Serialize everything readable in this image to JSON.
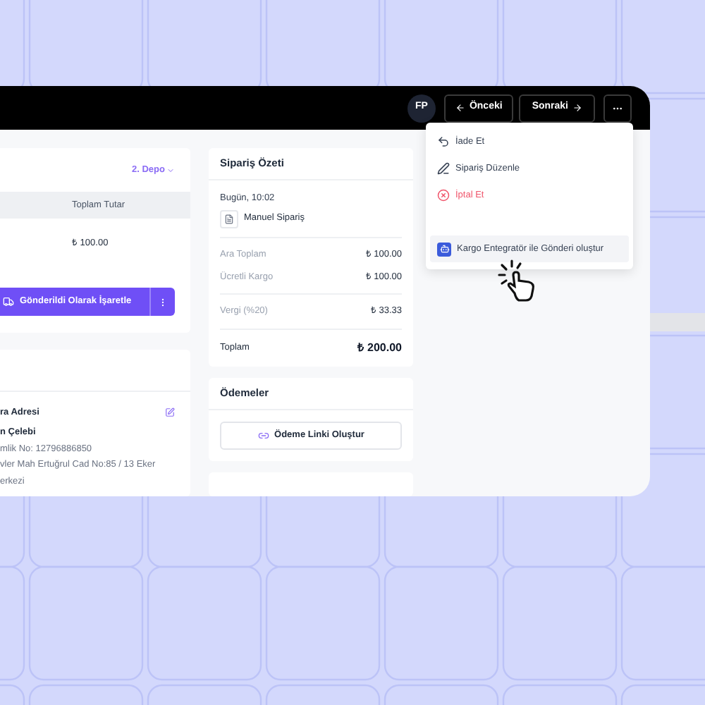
{
  "header": {
    "avatar": "FP",
    "prev": "Önceki",
    "next": "Sonraki"
  },
  "menu": {
    "items": [
      {
        "label": "İade Et",
        "kind": "return",
        "selected": false
      },
      {
        "label": "Sipariş Düzenle",
        "kind": "edit",
        "selected": false
      },
      {
        "label": "İptal Et",
        "kind": "danger",
        "selected": false
      },
      {
        "label": "Kargo Entegratör ile Gönderi oluştur",
        "kind": "integration",
        "selected": true
      }
    ]
  },
  "left_card": {
    "warehouse": "2. Depo",
    "column_header": "Toplam Tutar",
    "total": "₺ 100.00",
    "action": "Gönderildi Olarak İşaretle"
  },
  "address_card": {
    "title": "ra Adresi",
    "name": "n Çelebi",
    "lines": [
      "mlik No: 12796886850",
      "vler Mah Ertuğrul Cad No:85 / 13 Eker",
      "erkezi"
    ]
  },
  "summary": {
    "title": "Sipariş Özeti",
    "date": "Bugün, 10:02",
    "source": "Manuel Sipariş",
    "row_groups": [
      [
        {
          "label": "Ara Toplam",
          "value": "₺ 100.00"
        },
        {
          "label": "Ücretli Kargo",
          "value": "₺ 100.00"
        }
      ],
      [
        {
          "label": "Vergi (%20)",
          "value": "₺ 33.33"
        }
      ]
    ],
    "total_label": "Toplam",
    "total_value": "₺ 200.00"
  },
  "payments": {
    "title": "Ödemeler",
    "button": "Ödeme Linki Oluştur"
  }
}
